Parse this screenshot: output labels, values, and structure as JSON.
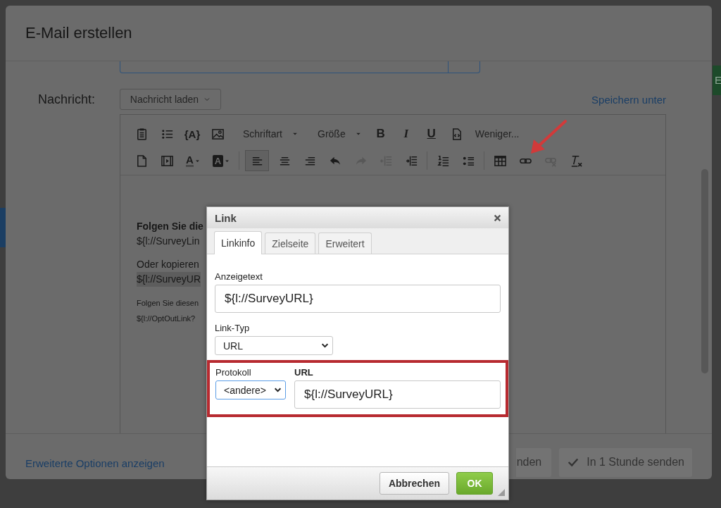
{
  "background": {
    "side_button": "E"
  },
  "window": {
    "title": "E-Mail erstellen"
  },
  "message": {
    "label": "Nachricht:",
    "load_dropdown": "Nachricht laden",
    "save_link": "Speichern unter"
  },
  "toolbar": {
    "rows": [
      [
        {
          "kind": "icon",
          "disabled": false,
          "active": false
        },
        {
          "kind": "icon",
          "disabled": false,
          "active": false
        },
        {
          "kind": "glyph",
          "label": "{A}"
        },
        {
          "kind": "icon",
          "disabled": false,
          "active": false
        },
        {
          "kind": "dropdown",
          "label": "Schriftart"
        },
        {
          "kind": "dropdown",
          "label": "Größe"
        },
        {
          "kind": "bold",
          "label": "B"
        },
        {
          "kind": "italic",
          "label": "I"
        },
        {
          "kind": "underline",
          "label": "U"
        },
        {
          "kind": "icon",
          "disabled": false,
          "active": false
        },
        {
          "kind": "more",
          "label": "Weniger..."
        }
      ],
      [
        {
          "kind": "icon",
          "disabled": false,
          "active": false
        },
        {
          "kind": "icon",
          "disabled": false,
          "active": false
        },
        {
          "kind": "color",
          "label": "A"
        },
        {
          "kind": "fill",
          "label": "A"
        },
        {
          "kind": "separator"
        },
        {
          "kind": "icon",
          "disabled": false,
          "active": true
        },
        {
          "kind": "icon",
          "disabled": false,
          "active": false
        },
        {
          "kind": "icon",
          "disabled": false,
          "active": false
        },
        {
          "kind": "icon",
          "disabled": false,
          "active": false
        },
        {
          "kind": "icon",
          "disabled": true,
          "active": false
        },
        {
          "kind": "icon",
          "disabled": true,
          "active": false
        },
        {
          "kind": "icon",
          "disabled": false,
          "active": false
        },
        {
          "kind": "separator"
        },
        {
          "kind": "icon",
          "disabled": false,
          "active": false
        },
        {
          "kind": "icon",
          "disabled": false,
          "active": false
        },
        {
          "kind": "separator"
        },
        {
          "kind": "icon",
          "disabled": false,
          "active": false
        },
        {
          "kind": "icon",
          "disabled": false,
          "active": false
        },
        {
          "kind": "icon",
          "disabled": true,
          "active": false
        },
        {
          "kind": "icon",
          "disabled": false,
          "active": false
        }
      ]
    ]
  },
  "editor": {
    "paragraphs": [
      {
        "kind": "body",
        "lines": [
          {
            "text": "Folgen Sie die",
            "bold": true,
            "highlighted": false
          },
          {
            "text": "${l://SurveyLin",
            "bold": false,
            "highlighted": false
          }
        ]
      },
      {
        "kind": "body",
        "lines": [
          {
            "text": "Oder kopieren",
            "bold": false,
            "highlighted": false
          },
          {
            "text": "${l://SurveyUR",
            "bold": false,
            "highlighted": true
          }
        ]
      },
      {
        "kind": "small",
        "lines": [
          {
            "text": "Folgen Sie diesen",
            "bold": false,
            "highlighted": false
          },
          {
            "text": "${l://OptOutLink?",
            "bold": false,
            "highlighted": false
          }
        ]
      }
    ]
  },
  "footer": {
    "advanced_link": "Erweiterte Optionen anzeigen",
    "buttons": [
      {
        "label": "nden",
        "kind": "plain",
        "disabled": true
      },
      {
        "label": "In 1 Stunde senden",
        "kind": "check",
        "disabled": true
      }
    ]
  },
  "dialog": {
    "title": "Link",
    "tabs": [
      {
        "label": "Linkinfo",
        "selected": true
      },
      {
        "label": "Zielseite",
        "selected": false
      },
      {
        "label": "Erweitert",
        "selected": false
      }
    ],
    "display_text": {
      "label": "Anzeigetext",
      "value": "${l://SurveyURL}"
    },
    "link_type": {
      "label": "Link-Typ",
      "value": "URL"
    },
    "protocol": {
      "label": "Protokoll",
      "value": "<andere>",
      "focused": true
    },
    "url": {
      "label": "URL",
      "value": "${l://SurveyURL}"
    },
    "buttons": [
      {
        "label": "Abbrechen",
        "kind": "secondary"
      },
      {
        "label": "OK",
        "kind": "primary"
      }
    ]
  }
}
